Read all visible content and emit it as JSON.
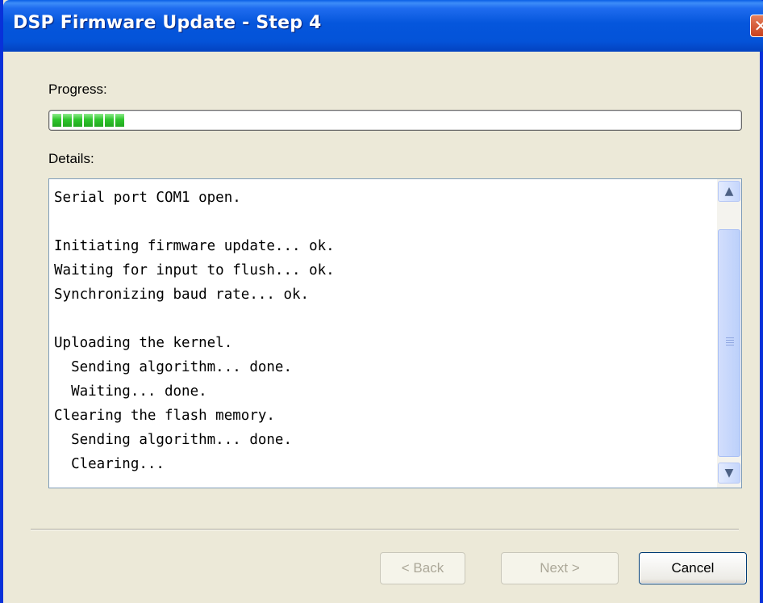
{
  "window": {
    "title": "DSP Firmware Update - Step 4",
    "close_glyph": "✕"
  },
  "progress": {
    "label": "Progress:",
    "fraction": 0.1
  },
  "details": {
    "label": "Details:",
    "log": "Serial port COM1 open.\n\nInitiating firmware update... ok.\nWaiting for input to flush... ok.\nSynchronizing baud rate... ok.\n\nUploading the kernel.\n  Sending algorithm... done.\n  Waiting... done.\nClearing the flash memory.\n  Sending algorithm... done.\n  Clearing..."
  },
  "scrollbar": {
    "up_glyph": "▲",
    "down_glyph": "▼"
  },
  "buttons": {
    "back": "< Back",
    "next": "Next >",
    "cancel": "Cancel"
  },
  "colors": {
    "titlebar": "#0453D8",
    "progress_fill": "#2EC52C",
    "window_bg": "#ECE9D8"
  }
}
